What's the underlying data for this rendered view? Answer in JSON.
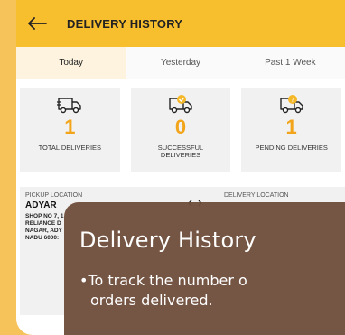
{
  "header": {
    "title": "DELIVERY HISTORY"
  },
  "tabs": [
    {
      "label": "Today",
      "active": true
    },
    {
      "label": "Yesterday",
      "active": false
    },
    {
      "label": "Past 1 Week",
      "active": false
    }
  ],
  "stats": [
    {
      "value": "1",
      "label": "TOTAL DELIVERIES",
      "icon": "truck-icon"
    },
    {
      "value": "0",
      "label": "SUCCESSFUL DELIVERIES",
      "icon": "truck-check-icon"
    },
    {
      "value": "1",
      "label": "PENDING DELIVERIES",
      "icon": "truck-pending-icon"
    }
  ],
  "delivery_detail": {
    "pickup": {
      "label": "PICKUP LOCATION",
      "name": "ADYAR",
      "address_lines": [
        "SHOP NO 7, 1",
        "RELIANCE D",
        "NAGAR, ADY",
        "NADU 6000:"
      ]
    },
    "delivery": {
      "label": "DELIVERY LOCATION"
    }
  },
  "overlay": {
    "title": "Delivery History",
    "bullet_line1": "•To track the number o",
    "bullet_line2": "orders delivered."
  },
  "colors": {
    "accent": "#f7be2e",
    "stat_value": "#f2a51a",
    "overlay_bg": "#6e4c3a"
  }
}
